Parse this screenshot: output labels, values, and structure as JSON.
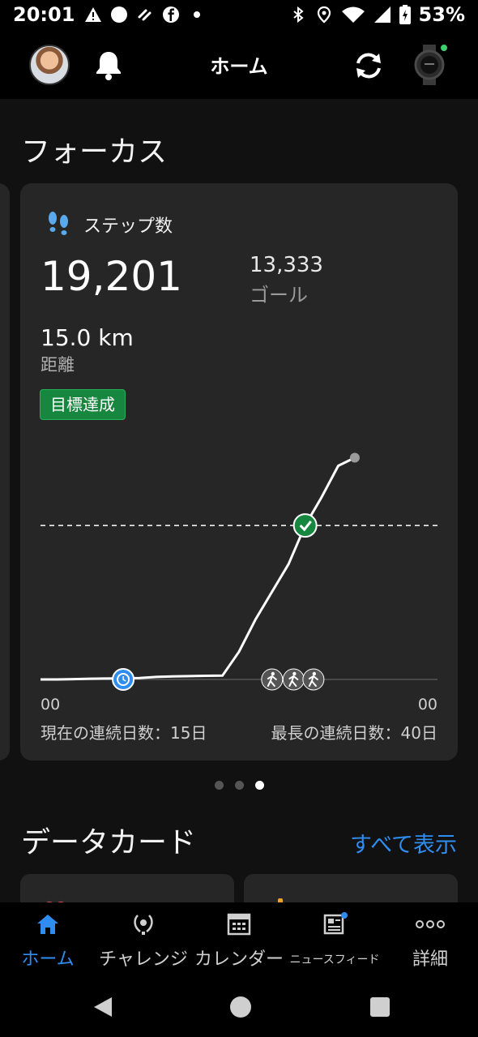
{
  "status_bar": {
    "time": "20:01",
    "battery": "53%",
    "left_icons": [
      "warning-icon",
      "circle-icon",
      "link-icon",
      "facebook-icon",
      "dot-icon"
    ],
    "right_icons": [
      "bluetooth-icon",
      "location-icon",
      "wifi-icon",
      "signal-icon",
      "battery-charging-icon"
    ]
  },
  "app_bar": {
    "title": "ホーム"
  },
  "focus": {
    "section_title": "フォーカス",
    "card": {
      "label": "ステップ数",
      "steps": "19,201",
      "goal_value": "13,333",
      "goal_label": "ゴール",
      "distance_value": "15.0 km",
      "distance_label": "距離",
      "badge": "目標達成",
      "axis_start": "00",
      "axis_end": "00",
      "current_streak": "現在の連続日数：15日",
      "longest_streak": "最長の連続日数：40日"
    },
    "pager": {
      "count": 3,
      "active": 3
    }
  },
  "chart_data": {
    "type": "line",
    "title": "",
    "xlabel": "",
    "ylabel": "",
    "x_tick_labels": [
      "00",
      "00"
    ],
    "x": [
      0,
      1,
      2,
      3,
      4,
      5,
      6,
      7,
      8,
      9,
      10,
      11,
      12,
      13,
      14,
      15,
      16,
      17,
      18,
      19,
      20,
      21
    ],
    "series": [
      {
        "values": [
          0,
          0,
          30,
          60,
          80,
          100,
          120,
          220,
          260,
          290,
          320,
          330,
          2400,
          5200,
          7600,
          10000,
          13333,
          15800,
          18500,
          19201,
          null,
          null
        ]
      }
    ],
    "goal_line": 13333,
    "ylim": [
      0,
      20500
    ],
    "xlim": [
      0,
      24
    ],
    "markers": [
      {
        "x": 5,
        "icon": "alarm-clock-icon",
        "color": "#2f8df0"
      },
      {
        "x": 14,
        "icon": "walking-icon",
        "color": "#555555"
      },
      {
        "x": 15.3,
        "icon": "walking-icon",
        "color": "#555555"
      },
      {
        "x": 16.5,
        "icon": "walking-icon",
        "color": "#555555"
      },
      {
        "x": 16,
        "icon": "check-icon",
        "color": "#17863f"
      }
    ],
    "colors": {
      "line": "#ffffff",
      "goal_line": "#ffffff",
      "end_point": "#9a9a9a"
    }
  },
  "data_cards": {
    "section_title": "データカード",
    "see_all": "すべて表示"
  },
  "bottom_nav": {
    "items": [
      {
        "label": "ホーム",
        "icon": "home-icon",
        "active": true
      },
      {
        "label": "チャレンジ",
        "icon": "laurel-icon",
        "active": false
      },
      {
        "label": "カレンダー",
        "icon": "calendar-icon",
        "active": false
      },
      {
        "label": "ニュースフィード",
        "icon": "newsfeed-icon",
        "active": false
      },
      {
        "label": "詳細",
        "icon": "more-icon",
        "active": false
      }
    ]
  },
  "colors": {
    "accent": "#2f8df0",
    "success": "#17863f",
    "card_bg": "#262626",
    "page_bg": "#111111"
  }
}
